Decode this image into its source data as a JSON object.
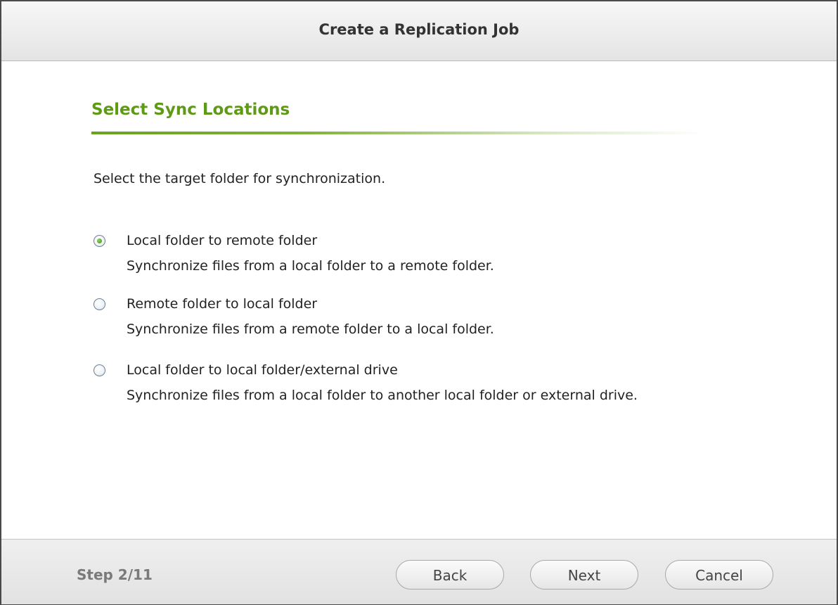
{
  "dialog": {
    "title": "Create a Replication Job"
  },
  "content": {
    "heading": "Select Sync Locations",
    "instruction": "Select the target folder for synchronization.",
    "options": [
      {
        "label": "Local folder to remote folder",
        "description": "Synchronize files from a local folder to a remote folder.",
        "selected": true
      },
      {
        "label": "Remote folder to local folder",
        "description": "Synchronize files from a remote folder to a local folder.",
        "selected": false
      },
      {
        "label": "Local folder to local folder/external drive",
        "description": "Synchronize files from a local folder to another local folder or external drive.",
        "selected": false
      }
    ]
  },
  "footer": {
    "step": "Step 2/11",
    "back_label": "Back",
    "next_label": "Next",
    "cancel_label": "Cancel"
  },
  "colors": {
    "accent": "#5f9a16",
    "radio_selected": "#3f8f15"
  }
}
